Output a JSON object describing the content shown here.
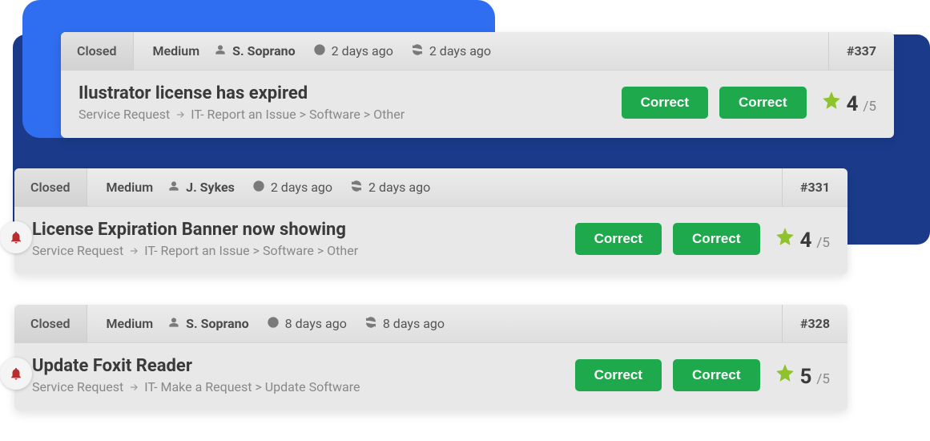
{
  "labels": {
    "correct": "Correct",
    "rating_max": "/5"
  },
  "tickets": [
    {
      "status": "Closed",
      "priority": "Medium",
      "assignee": "S. Soprano",
      "created": "2 days ago",
      "updated": "2 days ago",
      "id": "#337",
      "title": "Ilustrator license has expired",
      "crumb_type": "Service Request",
      "crumb_path": "IT- Report an Issue > Software > Other",
      "rating": "4",
      "has_notif": false
    },
    {
      "status": "Closed",
      "priority": "Medium",
      "assignee": "J. Sykes",
      "created": "2 days ago",
      "updated": "2 days ago",
      "id": "#331",
      "title": "License Expiration Banner now showing",
      "crumb_type": "Service Request",
      "crumb_path": "IT- Report an Issue > Software > Other",
      "rating": "4",
      "has_notif": true
    },
    {
      "status": "Closed",
      "priority": "Medium",
      "assignee": "S. Soprano",
      "created": "8 days ago",
      "updated": "8 days ago",
      "id": "#328",
      "title": "Update Foxit Reader",
      "crumb_type": "Service Request",
      "crumb_path": "IT- Make a Request > Update Software",
      "rating": "5",
      "has_notif": true
    }
  ]
}
